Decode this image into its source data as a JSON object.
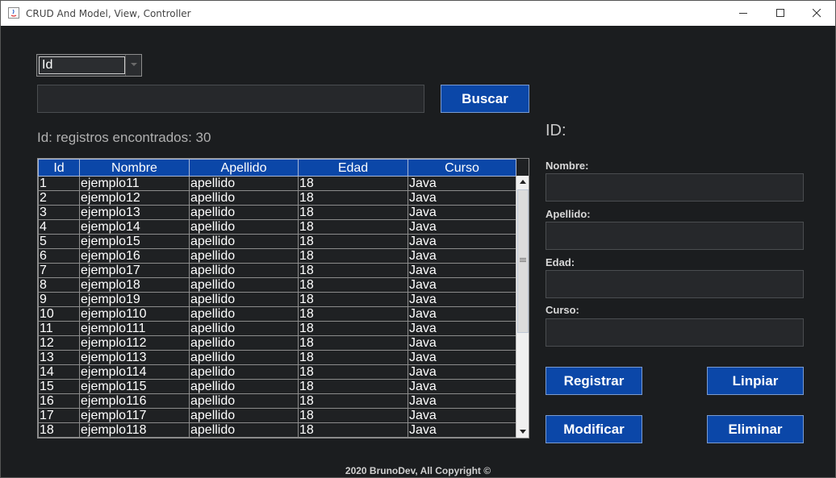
{
  "window": {
    "title": "CRUD And Model, View, Controller"
  },
  "search": {
    "combo_value": "Id",
    "search_value": "",
    "button_label": "Buscar",
    "found_text": "Id: registros encontrados: 30"
  },
  "table": {
    "columns": [
      "Id",
      "Nombre",
      "Apellido",
      "Edad",
      "Curso"
    ],
    "rows": [
      [
        "1",
        "ejemplo11",
        "apellido",
        "18",
        "Java"
      ],
      [
        "2",
        "ejemplo12",
        "apellido",
        "18",
        "Java"
      ],
      [
        "3",
        "ejemplo13",
        "apellido",
        "18",
        "Java"
      ],
      [
        "4",
        "ejemplo14",
        "apellido",
        "18",
        "Java"
      ],
      [
        "5",
        "ejemplo15",
        "apellido",
        "18",
        "Java"
      ],
      [
        "6",
        "ejemplo16",
        "apellido",
        "18",
        "Java"
      ],
      [
        "7",
        "ejemplo17",
        "apellido",
        "18",
        "Java"
      ],
      [
        "8",
        "ejemplo18",
        "apellido",
        "18",
        "Java"
      ],
      [
        "9",
        "ejemplo19",
        "apellido",
        "18",
        "Java"
      ],
      [
        "10",
        "ejemplo110",
        "apellido",
        "18",
        "Java"
      ],
      [
        "11",
        "ejemplo111",
        "apellido",
        "18",
        "Java"
      ],
      [
        "12",
        "ejemplo112",
        "apellido",
        "18",
        "Java"
      ],
      [
        "13",
        "ejemplo113",
        "apellido",
        "18",
        "Java"
      ],
      [
        "14",
        "ejemplo114",
        "apellido",
        "18",
        "Java"
      ],
      [
        "15",
        "ejemplo115",
        "apellido",
        "18",
        "Java"
      ],
      [
        "16",
        "ejemplo116",
        "apellido",
        "18",
        "Java"
      ],
      [
        "17",
        "ejemplo117",
        "apellido",
        "18",
        "Java"
      ],
      [
        "18",
        "ejemplo118",
        "apellido",
        "18",
        "Java"
      ]
    ]
  },
  "form": {
    "id_label": "ID:",
    "nombre_label": "Nombre:",
    "apellido_label": "Apellido:",
    "edad_label": "Edad:",
    "curso_label": "Curso:",
    "registrar_label": "Registrar",
    "limpiar_label": "Linpiar",
    "modificar_label": "Modificar",
    "eliminar_label": "Eliminar"
  },
  "footer": {
    "text": "2020 BrunoDev, All Copyright ©"
  },
  "colors": {
    "background": "#1b1d1f",
    "accent": "#0b47a8",
    "field": "#26282b"
  }
}
